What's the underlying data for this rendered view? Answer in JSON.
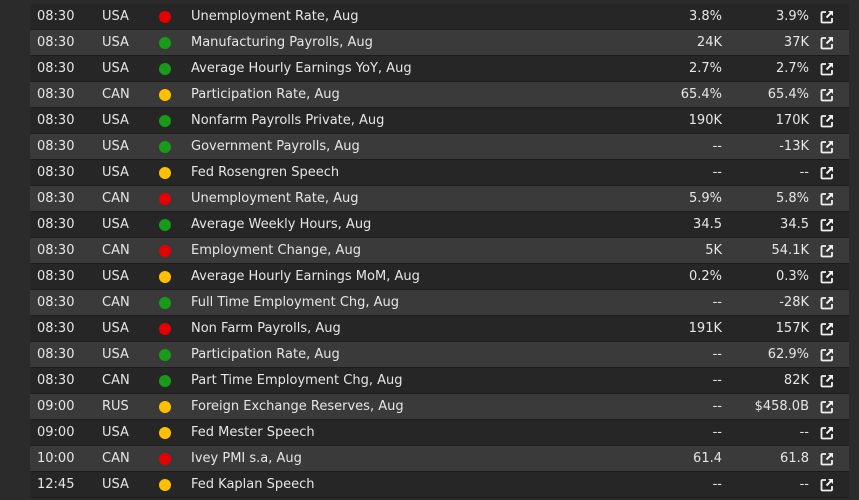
{
  "colors": {
    "high": "#e60000",
    "medium": "#ffc000",
    "low": "#1a9a1a"
  },
  "rows": [
    {
      "time": "08:30",
      "country": "USA",
      "impact": "high",
      "event": "Unemployment Rate, Aug",
      "forecast": "3.8%",
      "actual": "3.9%",
      "link_icon": "external-link-icon"
    },
    {
      "time": "08:30",
      "country": "USA",
      "impact": "low",
      "event": "Manufacturing Payrolls, Aug",
      "forecast": "24K",
      "actual": "37K",
      "link_icon": "external-link-icon"
    },
    {
      "time": "08:30",
      "country": "USA",
      "impact": "low",
      "event": "Average Hourly Earnings YoY, Aug",
      "forecast": "2.7%",
      "actual": "2.7%",
      "link_icon": "external-link-icon"
    },
    {
      "time": "08:30",
      "country": "CAN",
      "impact": "medium",
      "event": "Participation Rate, Aug",
      "forecast": "65.4%",
      "actual": "65.4%",
      "link_icon": "external-link-icon"
    },
    {
      "time": "08:30",
      "country": "USA",
      "impact": "low",
      "event": "Nonfarm Payrolls Private, Aug",
      "forecast": "190K",
      "actual": "170K",
      "link_icon": "external-link-icon"
    },
    {
      "time": "08:30",
      "country": "USA",
      "impact": "low",
      "event": "Government Payrolls, Aug",
      "forecast": "--",
      "actual": "-13K",
      "link_icon": "external-link-icon"
    },
    {
      "time": "08:30",
      "country": "USA",
      "impact": "medium",
      "event": "Fed Rosengren Speech",
      "forecast": "--",
      "actual": "--",
      "link_icon": "external-link-icon"
    },
    {
      "time": "08:30",
      "country": "CAN",
      "impact": "high",
      "event": "Unemployment Rate, Aug",
      "forecast": "5.9%",
      "actual": "5.8%",
      "link_icon": "external-link-icon"
    },
    {
      "time": "08:30",
      "country": "USA",
      "impact": "low",
      "event": "Average Weekly Hours, Aug",
      "forecast": "34.5",
      "actual": "34.5",
      "link_icon": "external-link-icon"
    },
    {
      "time": "08:30",
      "country": "CAN",
      "impact": "high",
      "event": "Employment Change, Aug",
      "forecast": "5K",
      "actual": "54.1K",
      "link_icon": "external-link-icon"
    },
    {
      "time": "08:30",
      "country": "USA",
      "impact": "medium",
      "event": "Average Hourly Earnings MoM, Aug",
      "forecast": "0.2%",
      "actual": "0.3%",
      "link_icon": "external-link-icon"
    },
    {
      "time": "08:30",
      "country": "CAN",
      "impact": "low",
      "event": "Full Time Employment Chg, Aug",
      "forecast": "--",
      "actual": "-28K",
      "link_icon": "external-link-icon"
    },
    {
      "time": "08:30",
      "country": "USA",
      "impact": "high",
      "event": "Non Farm Payrolls, Aug",
      "forecast": "191K",
      "actual": "157K",
      "link_icon": "external-link-icon"
    },
    {
      "time": "08:30",
      "country": "USA",
      "impact": "low",
      "event": "Participation Rate, Aug",
      "forecast": "--",
      "actual": "62.9%",
      "link_icon": "external-link-icon"
    },
    {
      "time": "08:30",
      "country": "CAN",
      "impact": "low",
      "event": "Part Time Employment Chg, Aug",
      "forecast": "--",
      "actual": "82K",
      "link_icon": "external-link-icon"
    },
    {
      "time": "09:00",
      "country": "RUS",
      "impact": "medium",
      "event": "Foreign Exchange Reserves, Aug",
      "forecast": "--",
      "actual": "$458.0B",
      "link_icon": "external-link-icon"
    },
    {
      "time": "09:00",
      "country": "USA",
      "impact": "medium",
      "event": "Fed Mester Speech",
      "forecast": "--",
      "actual": "--",
      "link_icon": "external-link-icon"
    },
    {
      "time": "10:00",
      "country": "CAN",
      "impact": "high",
      "event": "Ivey PMI s.a, Aug",
      "forecast": "61.4",
      "actual": "61.8",
      "link_icon": "external-link-icon"
    },
    {
      "time": "12:45",
      "country": "USA",
      "impact": "medium",
      "event": "Fed Kaplan Speech",
      "forecast": "--",
      "actual": "--",
      "link_icon": "external-link-icon"
    }
  ]
}
